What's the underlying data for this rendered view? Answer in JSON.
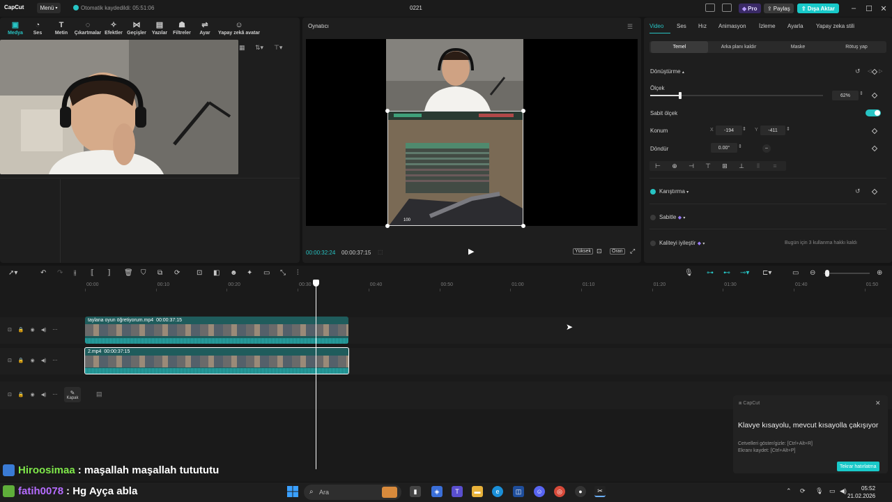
{
  "titlebar": {
    "app_name": "CapCut",
    "menu_label": "Menü",
    "autosave_text": "Otomatik kaydedildi: 05:51:06",
    "project_name": "0221",
    "pro_label": "Pro",
    "share_label": "Paylaş",
    "export_label": "Dışa Aktar"
  },
  "media_toolbar": {
    "tools": [
      {
        "label": "Medya",
        "icon": "media-icon",
        "active": true
      },
      {
        "label": "Ses",
        "icon": "audio-icon"
      },
      {
        "label": "Metin",
        "icon": "text-icon"
      },
      {
        "label": "Çıkartmalar",
        "icon": "sticker-icon"
      },
      {
        "label": "Efektler",
        "icon": "effects-icon"
      },
      {
        "label": "Geçişler",
        "icon": "transitions-icon"
      },
      {
        "label": "Yazılar",
        "icon": "captions-icon"
      },
      {
        "label": "Filtreler",
        "icon": "filters-icon"
      },
      {
        "label": "Ayar",
        "icon": "adjust-icon"
      },
      {
        "label": "Yapay zekâ avatar",
        "icon": "ai-avatar-icon"
      }
    ]
  },
  "player": {
    "title": "Oynatıcı",
    "current_time": "00:00:32:24",
    "total_time": "00:00:37:15",
    "quality_label": "Yüksek",
    "ratio_label": "Oran",
    "hud_ammo": "100"
  },
  "properties": {
    "tabs": [
      "Video",
      "Ses",
      "Hız",
      "Animasyon",
      "İzleme",
      "Ayarla",
      "Yapay zeka stili"
    ],
    "active_tab": "Video",
    "subtabs": [
      "Temel",
      "Arka planı kaldır",
      "Maske",
      "Rötuş yap"
    ],
    "transform_label": "Dönüştürme",
    "scale_label": "Ölçek",
    "scale_value": "62%",
    "scale_fraction": 0.62,
    "uniform_scale_label": "Sabit ölçek",
    "position_label": "Konum",
    "x_label": "X",
    "x_value": "-194",
    "y_label": "Y",
    "y_value": "-411",
    "rotate_label": "Döndür",
    "rotate_value": "0.00°",
    "blend_label": "Karıştırma",
    "stabilize_label": "Sabitle",
    "enhance_label": "Kaliteyi iyileştir",
    "enhance_note": "Bugün için 3 kullanma hakkı kaldı",
    "accent_color": "#27c4c4"
  },
  "timeline": {
    "ruler": [
      "00:00",
      "00:10",
      "00:20",
      "00:30",
      "00:40",
      "00:50",
      "01:00",
      "01:10",
      "01:20",
      "01:30",
      "01:40",
      "01:50"
    ],
    "clip1_name": "taylana oyun öğretiyorum.mp4",
    "clip1_duration": "00:00:37:15",
    "clip2_name": "2.mp4",
    "clip2_duration": "00:00:37:15",
    "cover_label": "Kapak"
  },
  "toast": {
    "brand": "CapCut",
    "title": "Klavye kısayolu, mevcut kısayolla çakışıyor",
    "line1": "Cetvelleri göster/gizle: [Ctrl+Alt+R]",
    "line2": "Ekranı kaydet: [Ctrl+Alt+P]",
    "button_label": "Tekrar hatırlatma"
  },
  "chat": [
    {
      "user": "Hiroosimaa",
      "message": ": maşallah maşallah tutututu",
      "user_color": "#7fe84a"
    },
    {
      "user": "fatih0078",
      "message": ": Hg Ayça abla",
      "user_color": "#b56cff"
    }
  ],
  "taskbar": {
    "search_placeholder": "Ara",
    "time": "05:52",
    "date": "21.02.2026"
  }
}
